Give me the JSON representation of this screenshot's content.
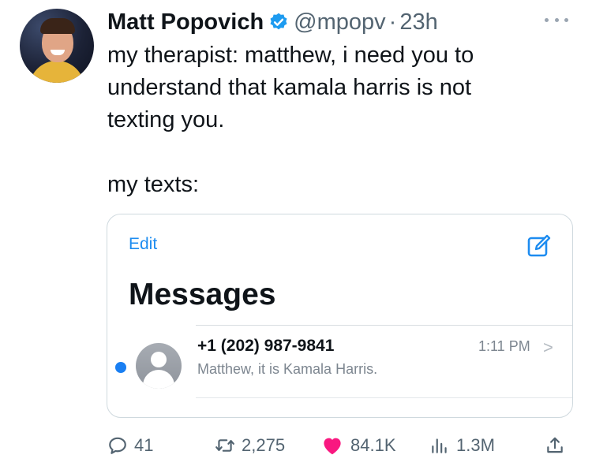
{
  "user": {
    "display_name": "Matt Popovich",
    "handle": "@mpopv",
    "separator": "·",
    "time": "23h"
  },
  "tweet": {
    "lines": [
      "my therapist: matthew, i need you to",
      "understand that kamala harris is not",
      "texting you."
    ],
    "followup": "my texts:"
  },
  "embedded": {
    "edit_label": "Edit",
    "title": "Messages",
    "conversation": {
      "sender": "+1 (202) 987-9841",
      "preview": "Matthew, it is Kamala Harris.",
      "time": "1:11 PM",
      "chevron": ">",
      "unread": true
    }
  },
  "stats": {
    "replies": "41",
    "retweets": "2,275",
    "likes": "84.1K",
    "views": "1.3M"
  },
  "colors": {
    "verified_blue": "#1d9bf0",
    "like_pink": "#f91880",
    "ios_blue": "#1a7ff2"
  }
}
